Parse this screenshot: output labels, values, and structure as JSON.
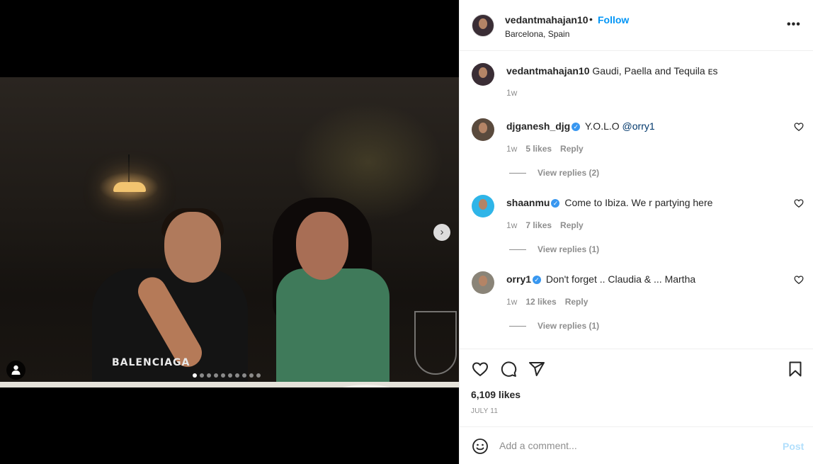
{
  "post": {
    "username": "vedantmahajan10",
    "follow_label": "Follow",
    "separator": "•",
    "location": "Barcelona, Spain",
    "more_label": "•••",
    "photo_text": "BALENCIAGA",
    "carousel_dots": 10,
    "carousel_active_index": 0
  },
  "caption": {
    "username": "vedantmahajan10",
    "text": "Gaudi, Paella and Tequila ᴇs",
    "time": "1w"
  },
  "comments": [
    {
      "username": "djganesh_djg",
      "verified": true,
      "text": "Y.O.L.O",
      "mention": "@orry1",
      "suffix": "󠀠󠀠",
      "time": "1w",
      "likes": "5 likes",
      "reply_label": "Reply",
      "view_replies": "View replies (2)"
    },
    {
      "username": "shaanmu",
      "verified": true,
      "text": "Come to Ibiza. We r partying here",
      "mention": "",
      "suffix": "",
      "time": "1w",
      "likes": "7 likes",
      "reply_label": "Reply",
      "view_replies": "View replies (1)"
    },
    {
      "username": "orry1",
      "verified": true,
      "text": "Don't forget .. Claudia & ... Martha",
      "mention": "",
      "suffix": "󠀠󠀠󠀠󠀠",
      "time": "1w",
      "likes": "12 likes",
      "reply_label": "Reply",
      "view_replies": "View replies (1)"
    }
  ],
  "stats": {
    "likes": "6,109 likes",
    "date": "JULY 11"
  },
  "add_comment": {
    "placeholder": "Add a comment...",
    "post_label": "Post"
  },
  "colors": {
    "accent": "#0095f6",
    "verified": "#3897f0",
    "post_disabled": "#b2dffc",
    "muted": "#8e8e8e"
  }
}
